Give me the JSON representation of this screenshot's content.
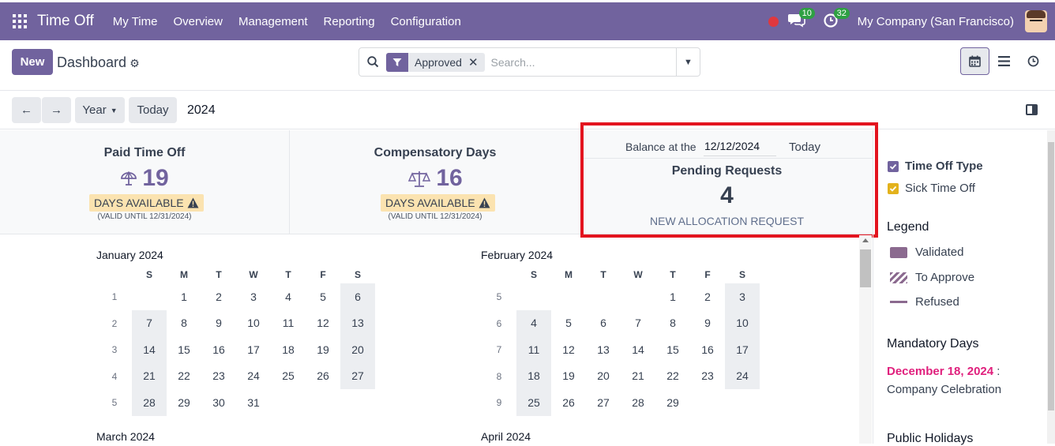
{
  "app": {
    "brand": "Time Off",
    "menu": [
      "My Time",
      "Overview",
      "Management",
      "Reporting",
      "Configuration"
    ],
    "chat_count": "10",
    "activity_count": "32",
    "company": "My Company (San Francisco)"
  },
  "control": {
    "new_label": "New",
    "title": "Dashboard",
    "facet": "Approved",
    "search_placeholder": "Search..."
  },
  "toolbar": {
    "scale": "Year",
    "today": "Today",
    "current": "2024"
  },
  "cards": [
    {
      "title": "Paid Time Off",
      "value": "19",
      "icon": "umbrella-icon",
      "avail": "DAYS AVAILABLE",
      "valid": "(VALID UNTIL 12/31/2024)"
    },
    {
      "title": "Compensatory Days",
      "value": "16",
      "icon": "scale-icon",
      "avail": "DAYS AVAILABLE",
      "valid": "(VALID UNTIL 12/31/2024)"
    }
  ],
  "balance": {
    "label": "Balance at the",
    "date": "12/12/2024",
    "today": "Today",
    "pending_title": "Pending Requests",
    "pending_count": "4",
    "allocation_link": "NEW ALLOCATION REQUEST"
  },
  "calendar": {
    "dow": [
      "S",
      "M",
      "T",
      "W",
      "T",
      "F",
      "S"
    ],
    "months": [
      {
        "name": "January 2024",
        "weeks": [
          {
            "num": "1",
            "days": [
              "",
              "1",
              "2",
              "3",
              "4",
              "5",
              "6"
            ]
          },
          {
            "num": "2",
            "days": [
              "7",
              "8",
              "9",
              "10",
              "11",
              "12",
              "13"
            ]
          },
          {
            "num": "3",
            "days": [
              "14",
              "15",
              "16",
              "17",
              "18",
              "19",
              "20"
            ]
          },
          {
            "num": "4",
            "days": [
              "21",
              "22",
              "23",
              "24",
              "25",
              "26",
              "27"
            ]
          },
          {
            "num": "5",
            "days": [
              "28",
              "29",
              "30",
              "31",
              "",
              "",
              ""
            ]
          }
        ]
      },
      {
        "name": "February 2024",
        "weeks": [
          {
            "num": "5",
            "days": [
              "",
              "",
              "",
              "",
              "1",
              "2",
              "3"
            ]
          },
          {
            "num": "6",
            "days": [
              "4",
              "5",
              "6",
              "7",
              "8",
              "9",
              "10"
            ]
          },
          {
            "num": "7",
            "days": [
              "11",
              "12",
              "13",
              "14",
              "15",
              "16",
              "17"
            ]
          },
          {
            "num": "8",
            "days": [
              "18",
              "19",
              "20",
              "21",
              "22",
              "23",
              "24"
            ]
          },
          {
            "num": "9",
            "days": [
              "25",
              "26",
              "27",
              "28",
              "29",
              "",
              ""
            ]
          }
        ]
      },
      {
        "name": "March 2024",
        "weeks": []
      },
      {
        "name": "April 2024",
        "weeks": []
      }
    ]
  },
  "side": {
    "filters": [
      {
        "label": "Time Off Type",
        "color": "#71639e",
        "bold": true
      },
      {
        "label": "Sick Time Off",
        "color": "#e3b21c",
        "bold": false
      }
    ],
    "legend_title": "Legend",
    "legend": [
      {
        "label": "Validated",
        "style": "solid"
      },
      {
        "label": "To Approve",
        "style": "striped"
      },
      {
        "label": "Refused",
        "style": "line"
      }
    ],
    "mandatory_title": "Mandatory Days",
    "mandatory_date": "December 18, 2024",
    "mandatory_name": "Company Celebration",
    "public_title": "Public Holidays"
  },
  "colors": {
    "brand": "#71639e",
    "highlight": "#e3141f",
    "mandatory": "#e0207d"
  }
}
